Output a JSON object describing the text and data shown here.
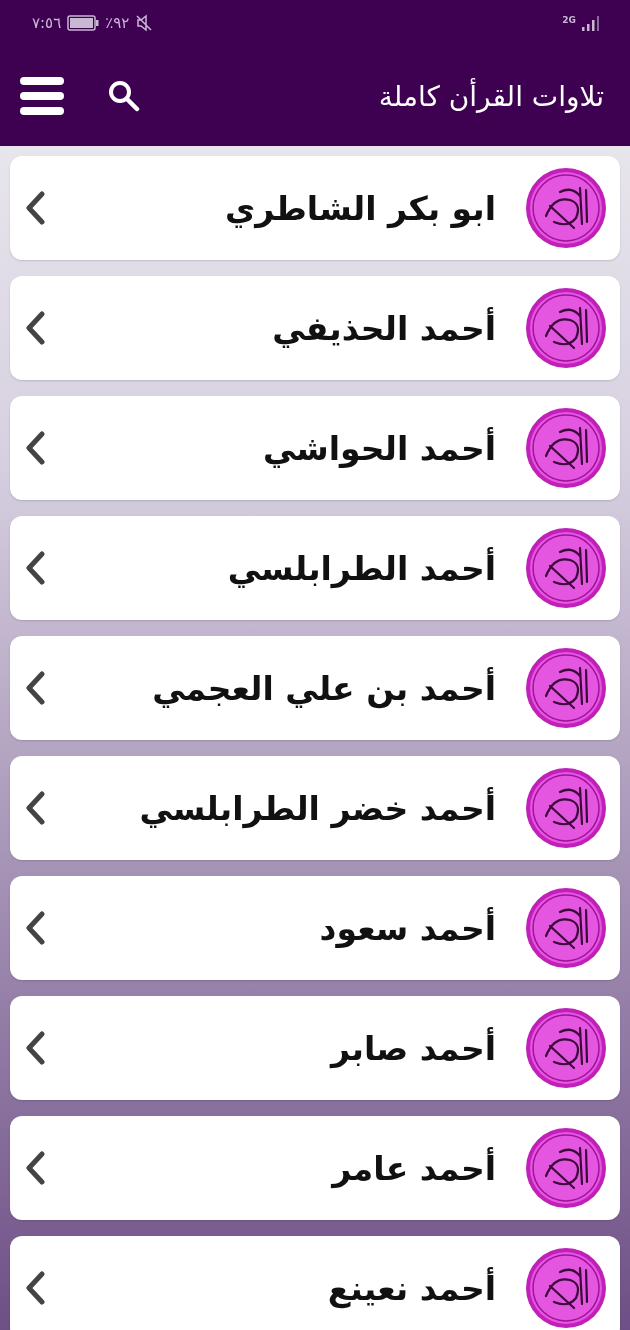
{
  "status_bar": {
    "time": "٧:٥٦",
    "battery": "٪٩٢",
    "network": "2G"
  },
  "app_bar": {
    "title": "تلاوات القرأن كاملة"
  },
  "reciters": [
    {
      "name": "ابو بكر الشاطري"
    },
    {
      "name": "أحمد الحذيفي"
    },
    {
      "name": "أحمد الحواشي"
    },
    {
      "name": "أحمد الطرابلسي"
    },
    {
      "name": "أحمد بن علي العجمي"
    },
    {
      "name": "أحمد خضر الطرابلسي"
    },
    {
      "name": "أحمد سعود"
    },
    {
      "name": "أحمد صابر"
    },
    {
      "name": "أحمد عامر"
    },
    {
      "name": "أحمد نعينع"
    }
  ]
}
